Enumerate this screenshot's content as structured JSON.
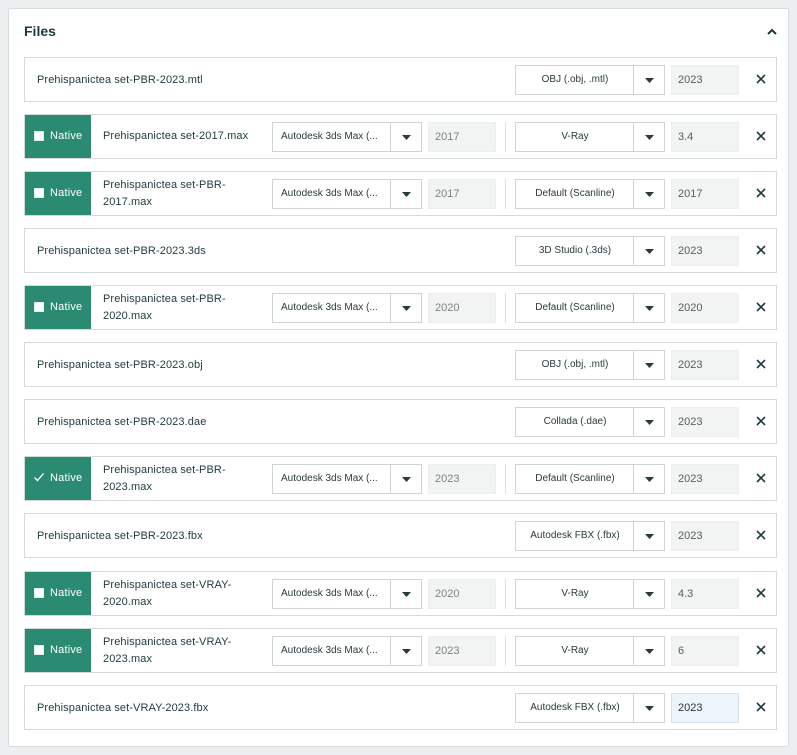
{
  "panel": {
    "title": "Files"
  },
  "rows": [
    {
      "type": "simple",
      "name": "Prehispanictea set-PBR-2023.mtl",
      "format": "OBJ (.obj, .mtl)",
      "version": "2023"
    },
    {
      "type": "native",
      "checked": false,
      "native_label": "Native",
      "name": "Prehispanictea set-2017.max",
      "app": "Autodesk 3ds Max (...",
      "app_version": "2017",
      "renderer": "V-Ray",
      "renderer_version": "3.4"
    },
    {
      "type": "native",
      "checked": false,
      "native_label": "Native",
      "name": "Prehispanictea set-PBR-2017.max",
      "app": "Autodesk 3ds Max (...",
      "app_version": "2017",
      "renderer": "Default (Scanline)",
      "renderer_version": "2017"
    },
    {
      "type": "simple",
      "name": "Prehispanictea set-PBR-2023.3ds",
      "format": "3D Studio (.3ds)",
      "version": "2023"
    },
    {
      "type": "native",
      "checked": false,
      "native_label": "Native",
      "name": "Prehispanictea set-PBR-2020.max",
      "app": "Autodesk 3ds Max (...",
      "app_version": "2020",
      "renderer": "Default (Scanline)",
      "renderer_version": "2020"
    },
    {
      "type": "simple",
      "name": "Prehispanictea set-PBR-2023.obj",
      "format": "OBJ (.obj, .mtl)",
      "version": "2023"
    },
    {
      "type": "simple",
      "name": "Prehispanictea set-PBR-2023.dae",
      "format": "Collada (.dae)",
      "version": "2023"
    },
    {
      "type": "native",
      "checked": true,
      "native_label": "Native",
      "name": "Prehispanictea set-PBR-2023.max",
      "app": "Autodesk 3ds Max (...",
      "app_version": "2023",
      "renderer": "Default (Scanline)",
      "renderer_version": "2023"
    },
    {
      "type": "simple",
      "name": "Prehispanictea set-PBR-2023.fbx",
      "format": "Autodesk FBX (.fbx)",
      "version": "2023"
    },
    {
      "type": "native",
      "checked": false,
      "native_label": "Native",
      "name": "Prehispanictea set-VRAY-2020.max",
      "app": "Autodesk 3ds Max (...",
      "app_version": "2020",
      "renderer": "V-Ray",
      "renderer_version": "4.3"
    },
    {
      "type": "native",
      "checked": false,
      "native_label": "Native",
      "name": "Prehispanictea set-VRAY-2023.max",
      "app": "Autodesk 3ds Max (...",
      "app_version": "2023",
      "renderer": "V-Ray",
      "renderer_version": "6"
    },
    {
      "type": "simple",
      "name": "Prehispanictea set-VRAY-2023.fbx",
      "format": "Autodesk FBX (.fbx)",
      "version": "2023",
      "focused": true
    }
  ],
  "icons": {
    "collapse": "chevron-up-icon",
    "remove": "close-icon",
    "dropdown": "caret-down-icon",
    "check": "check-icon"
  },
  "colors": {
    "native_bg": "#2b8a72",
    "text": "#1f3a3f",
    "focused_input": "#eef4fb"
  }
}
